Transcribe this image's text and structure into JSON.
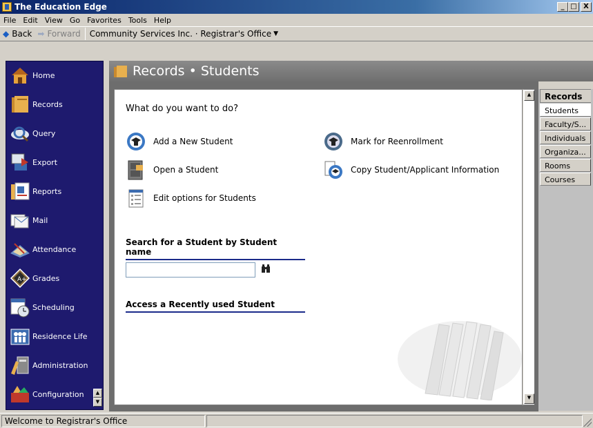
{
  "window": {
    "title": "The Education Edge",
    "buttons": [
      "_",
      "□",
      "X"
    ]
  },
  "menu": [
    "File",
    "Edit",
    "View",
    "Go",
    "Favorites",
    "Tools",
    "Help"
  ],
  "navbar": {
    "back": "Back",
    "forward": "Forward",
    "breadcrumb": "Community Services Inc. · Registrar's Office"
  },
  "sidebar": {
    "items": [
      {
        "label": "Home",
        "icon": "house-icon"
      },
      {
        "label": "Records",
        "icon": "folders-icon"
      },
      {
        "label": "Query",
        "icon": "magnifier-icon"
      },
      {
        "label": "Export",
        "icon": "export-icon"
      },
      {
        "label": "Reports",
        "icon": "report-icon"
      },
      {
        "label": "Mail",
        "icon": "mail-icon"
      },
      {
        "label": "Attendance",
        "icon": "attendance-icon"
      },
      {
        "label": "Grades",
        "icon": "grades-icon"
      },
      {
        "label": "Scheduling",
        "icon": "clock-icon"
      },
      {
        "label": "Residence Life",
        "icon": "people-icon"
      },
      {
        "label": "Administration",
        "icon": "tools-icon"
      },
      {
        "label": "Configuration",
        "icon": "config-icon"
      }
    ]
  },
  "header": {
    "title": "Records • Students"
  },
  "main": {
    "question": "What do you want to do?",
    "tasks": [
      {
        "label": "Add a New Student",
        "icon": "add-student-icon"
      },
      {
        "label": "Open a Student",
        "icon": "open-cabinet-icon"
      },
      {
        "label": "Edit options for Students",
        "icon": "edit-options-icon"
      },
      {
        "label": "Mark for Reenrollment",
        "icon": "reenroll-icon"
      },
      {
        "label": "Copy Student/Applicant Information",
        "icon": "copy-student-icon"
      }
    ],
    "search_heading": "Search for a Student by Student name",
    "search_value": "",
    "recent_heading": "Access a Recently used Student"
  },
  "right_tabs": {
    "title": "Records",
    "tabs": [
      "Students",
      "Faculty/S...",
      "Individuals",
      "Organiza...",
      "Rooms",
      "Courses"
    ],
    "active": "Students"
  },
  "statusbar": {
    "text": "Welcome to Registrar's Office"
  }
}
